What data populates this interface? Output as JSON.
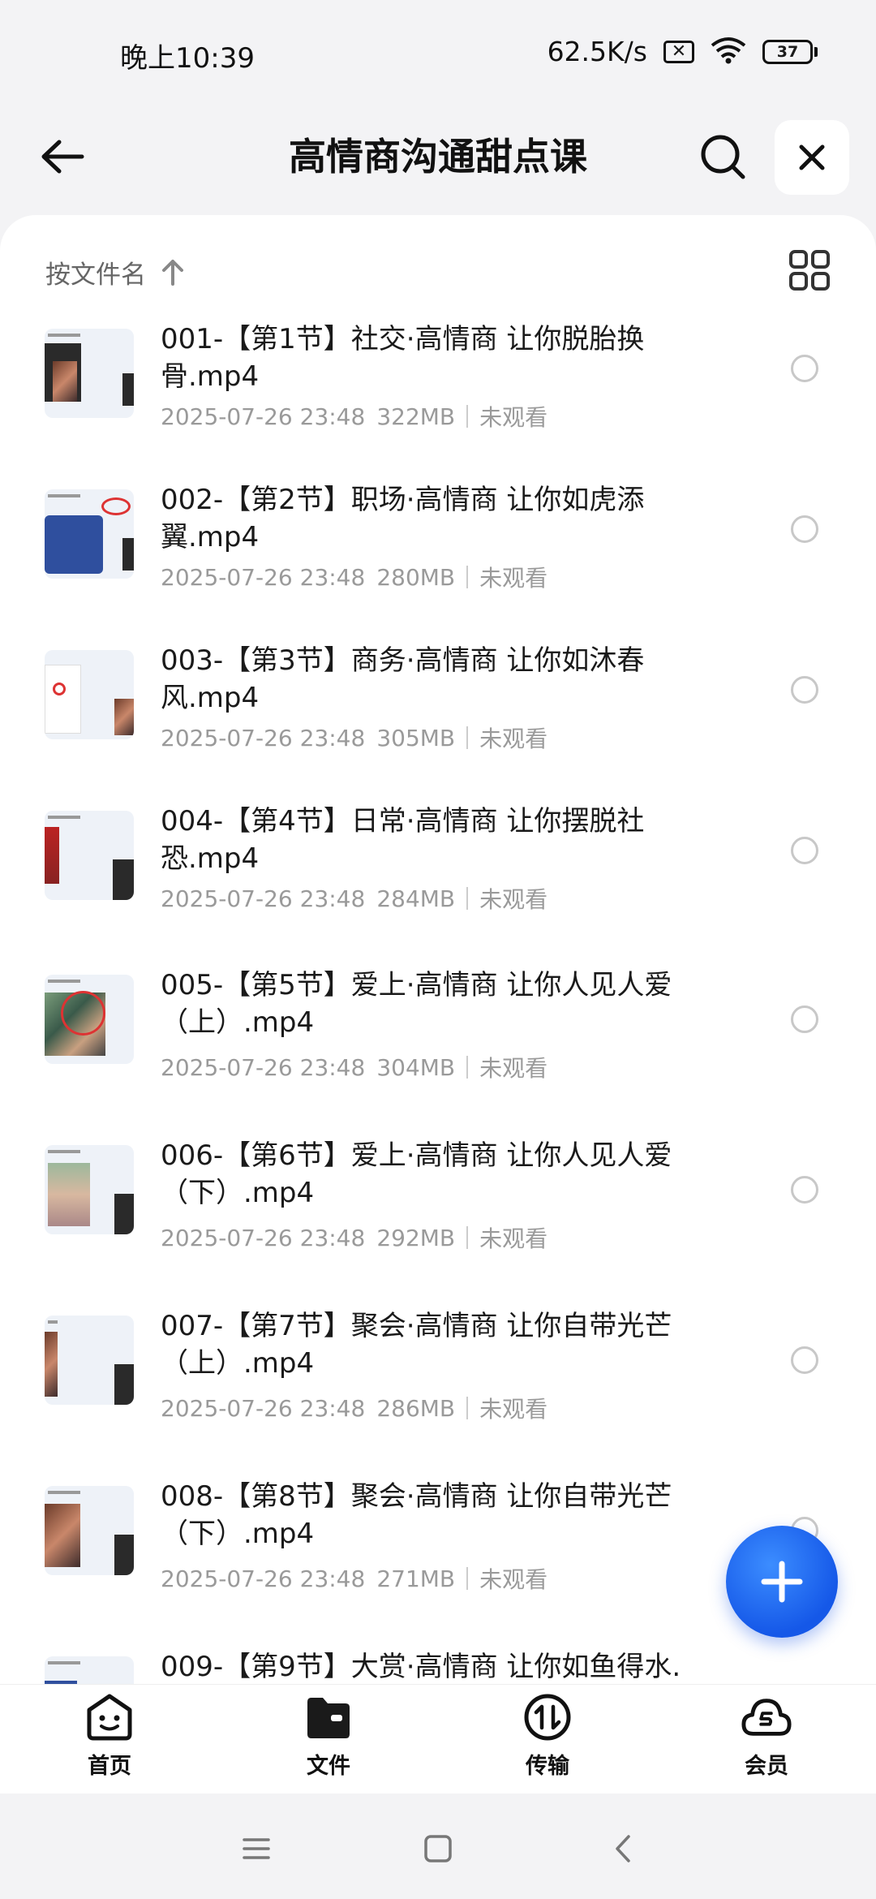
{
  "status_bar": {
    "time": "晚上10:39",
    "net_speed": "62.5K/s",
    "battery": "37"
  },
  "header": {
    "title": "高情商沟通甜点课"
  },
  "sort": {
    "label": "按文件名"
  },
  "files": [
    {
      "name": "001-【第1节】社交·高情商 让你脱胎换骨.mp4",
      "date": "2025-07-26 23:48",
      "size": "322MB",
      "status": "未观看"
    },
    {
      "name": "002-【第2节】职场·高情商 让你如虎添翼.mp4",
      "date": "2025-07-26 23:48",
      "size": "280MB",
      "status": "未观看"
    },
    {
      "name": "003-【第3节】商务·高情商 让你如沐春风.mp4",
      "date": "2025-07-26 23:48",
      "size": "305MB",
      "status": "未观看"
    },
    {
      "name": "004-【第4节】日常·高情商 让你摆脱社恐.mp4",
      "date": "2025-07-26 23:48",
      "size": "284MB",
      "status": "未观看"
    },
    {
      "name": "005-【第5节】爱上·高情商 让你人见人爱（上）.mp4",
      "date": "2025-07-26 23:48",
      "size": "304MB",
      "status": "未观看"
    },
    {
      "name": "006-【第6节】爱上·高情商 让你人见人爱（下）.mp4",
      "date": "2025-07-26 23:48",
      "size": "292MB",
      "status": "未观看"
    },
    {
      "name": "007-【第7节】聚会·高情商 让你自带光芒（上）.mp4",
      "date": "2025-07-26 23:48",
      "size": "286MB",
      "status": "未观看"
    },
    {
      "name": "008-【第8节】聚会·高情商 让你自带光芒（下）.mp4",
      "date": "2025-07-26 23:48",
      "size": "271MB",
      "status": "未观看"
    },
    {
      "name": "009-【第9节】大赏·高情商 让你如鱼得水.",
      "date": "",
      "size": "",
      "status": ""
    }
  ],
  "bottom_nav": [
    {
      "label": "首页",
      "icon": "home-face-icon"
    },
    {
      "label": "文件",
      "icon": "folder-icon"
    },
    {
      "label": "传输",
      "icon": "transfer-icon"
    },
    {
      "label": "会员",
      "icon": "vip-cloud-icon"
    }
  ],
  "colors": {
    "accent": "#1f6bf0",
    "meta_text": "#9a9a9a",
    "page_bg": "#f3f3f5"
  }
}
